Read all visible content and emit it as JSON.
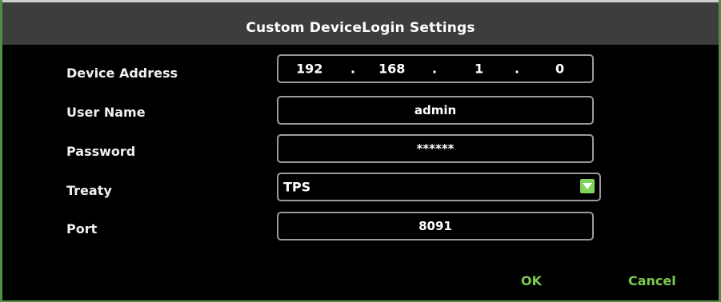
{
  "dialog": {
    "title": "Custom DeviceLogin Settings"
  },
  "fields": {
    "device_address": {
      "label": "Device Address",
      "octets": [
        "192",
        "168",
        "1",
        "0"
      ],
      "separator": "."
    },
    "user_name": {
      "label": "User Name",
      "value": "admin"
    },
    "password": {
      "label": "Password",
      "value": "******"
    },
    "treaty": {
      "label": "Treaty",
      "value": "TPS",
      "dropdown_icon": "chevron-down-icon"
    },
    "port": {
      "label": "Port",
      "value": "8091"
    }
  },
  "buttons": {
    "ok_label": "OK",
    "cancel_label": "Cancel"
  },
  "colors": {
    "accent": "#7cc94e",
    "border": "#4f8f47",
    "titlebar": "#3d3d3d"
  }
}
